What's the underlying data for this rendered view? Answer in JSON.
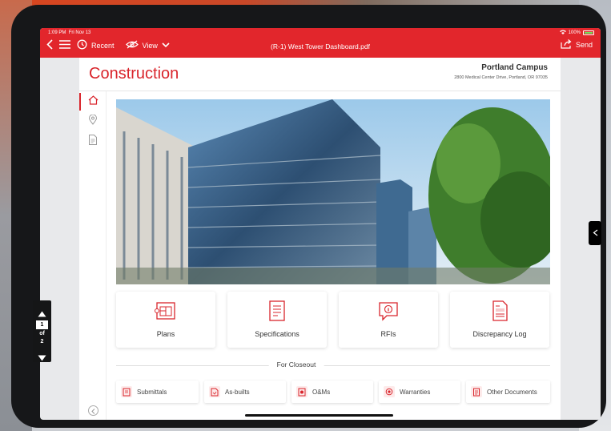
{
  "status": {
    "time": "1:09 PM",
    "date": "Fri Nov 13",
    "battery": "100%"
  },
  "toolbar": {
    "recent_label": "Recent",
    "view_label": "View",
    "document_title": "(R-1) West Tower Dashboard.pdf",
    "send_label": "Send"
  },
  "page": {
    "title": "Construction",
    "campus_name": "Portland Campus",
    "campus_address": "2800 Medical Center Drive, Portland, OR 97035"
  },
  "cards": [
    {
      "label": "Plans",
      "icon": "blueprint-icon"
    },
    {
      "label": "Specifications",
      "icon": "document-list-icon"
    },
    {
      "label": "RFIs",
      "icon": "info-bubble-icon"
    },
    {
      "label": "Discrepancy Log",
      "icon": "report-icon"
    }
  ],
  "closeout": {
    "heading": "For Closeout",
    "items": [
      {
        "label": "Submittals",
        "icon": "submittals-icon"
      },
      {
        "label": "As-builts",
        "icon": "as-builts-icon"
      },
      {
        "label": "O&Ms",
        "icon": "manual-icon"
      },
      {
        "label": "Warranties",
        "icon": "seal-icon"
      },
      {
        "label": "Other Documents",
        "icon": "documents-icon"
      }
    ]
  },
  "pager": {
    "current": "1",
    "of": "of",
    "total": "2"
  },
  "colors": {
    "accent": "#e2262c",
    "title_red": "#d9252c"
  }
}
